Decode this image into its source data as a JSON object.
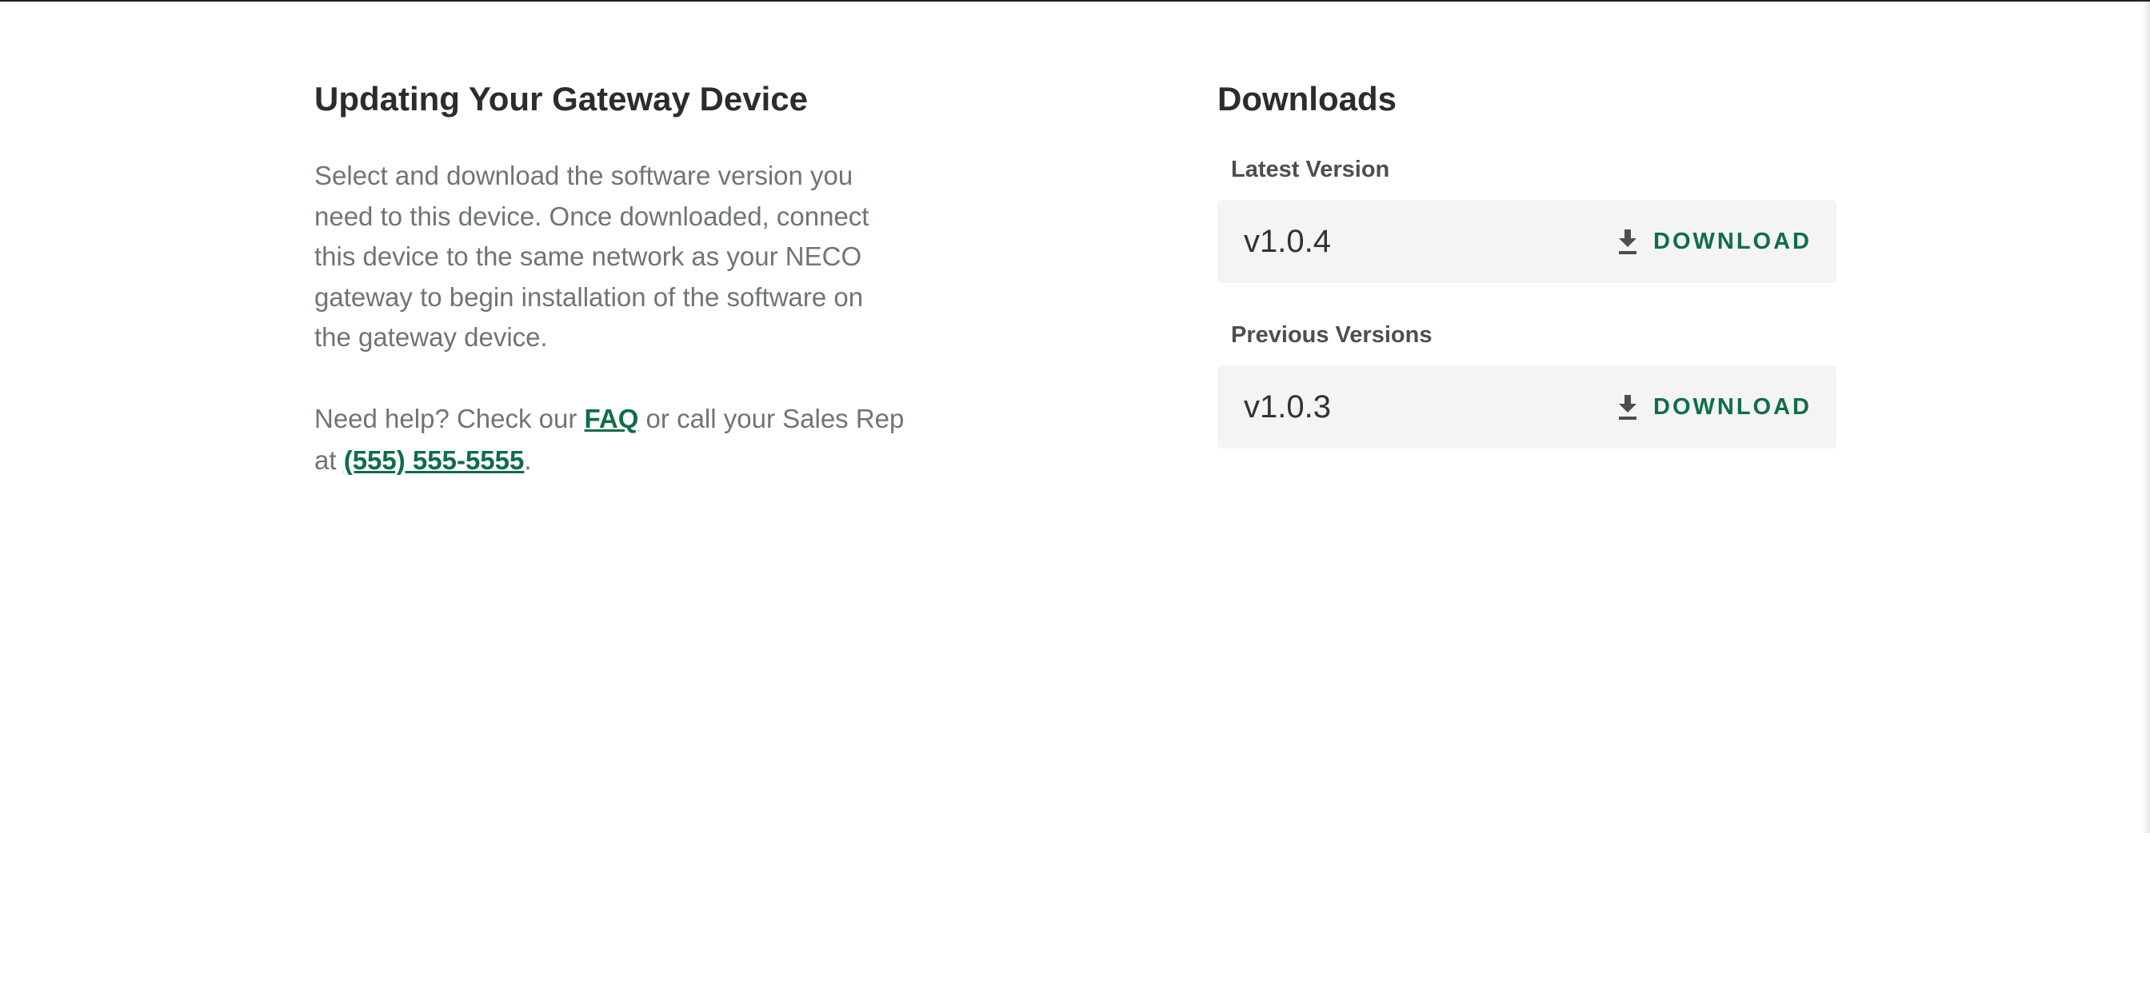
{
  "gateway": {
    "title": "Updating Your Gateway Device",
    "description": "Select and download the software version you need to this device. Once downloaded, connect this device to the same network as your NECO gateway to begin installation of the software on the gateway device.",
    "help_prefix": "Need help? Check our ",
    "faq_link": "FAQ",
    "help_middle": " or call your Sales Rep at ",
    "phone_link": "(555) 555-5555",
    "help_suffix": "."
  },
  "downloads": {
    "title": "Downloads",
    "latest_label": "Latest Version",
    "latest_version": "v1.0.4",
    "previous_label": "Previous Versions",
    "previous_versions": [
      "v1.0.3"
    ],
    "download_label": "DOWNLOAD",
    "download_icon": "download-icon"
  },
  "colors": {
    "accent": "#0f6e47",
    "card_bg": "#f3f4f3",
    "body_text": "#6f7672",
    "heading": "#2a2d2c"
  }
}
